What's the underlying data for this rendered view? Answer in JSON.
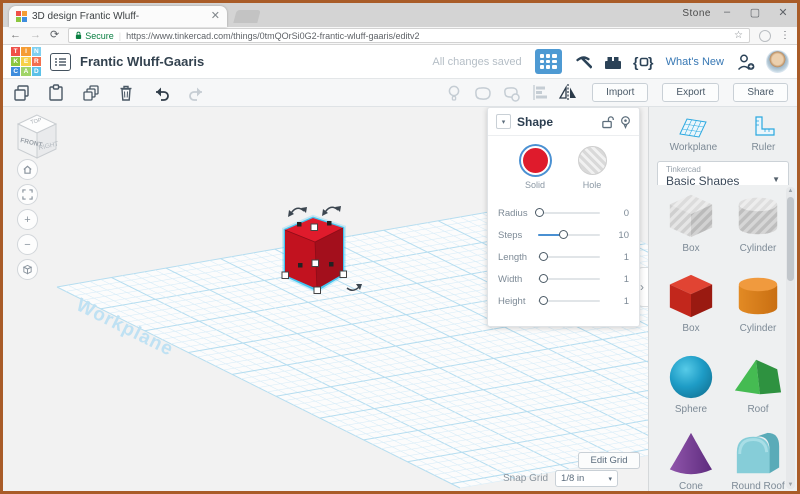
{
  "window": {
    "profile_name": "Stone"
  },
  "browser": {
    "tab_title": "3D design Frantic Wluff-",
    "secure_label": "Secure",
    "url": "https://www.tinkercad.com/things/0tmQOrSi0G2-frantic-wluff-gaaris/editv2"
  },
  "colors": {
    "accent_blue": "#4e9ad3",
    "selection_cyan": "#45c6f2",
    "cube_red": "#d6182b",
    "secure_green": "#0b8043",
    "link_blue": "#3878b4",
    "frame_orange": "#a95c28"
  },
  "app_header": {
    "logo": [
      {
        "ch": "T",
        "color": "#ef5048"
      },
      {
        "ch": "I",
        "color": "#f59c33"
      },
      {
        "ch": "N",
        "color": "#7fd0f0"
      },
      {
        "ch": "K",
        "color": "#8cc63f"
      },
      {
        "ch": "E",
        "color": "#f7d148"
      },
      {
        "ch": "R",
        "color": "#f2704d"
      },
      {
        "ch": "C",
        "color": "#3e8ddd"
      },
      {
        "ch": "A",
        "color": "#a0d468"
      },
      {
        "ch": "D",
        "color": "#5bc1e8"
      }
    ],
    "design_title": "Frantic Wluff-Gaaris",
    "save_status": "All changes saved",
    "whats_new_label": "What's New"
  },
  "toolbar": {
    "import_label": "Import",
    "export_label": "Export",
    "share_label": "Share"
  },
  "viewcube": {
    "top": "TOP",
    "front": "FRONT",
    "right": "RIGHT"
  },
  "canvas": {
    "workplane_watermark": "Workplane",
    "edit_grid_label": "Edit Grid",
    "snap_grid_label": "Snap Grid",
    "snap_grid_value": "1/8 in"
  },
  "shape_panel": {
    "title": "Shape",
    "options": [
      {
        "label": "Solid",
        "selected": true
      },
      {
        "label": "Hole",
        "selected": false
      }
    ],
    "sliders": [
      {
        "label": "Radius",
        "value": "0",
        "fill": 0.03
      },
      {
        "label": "Steps",
        "value": "10",
        "fill": 0.42
      },
      {
        "label": "Length",
        "value": "1",
        "fill": 0.1
      },
      {
        "label": "Width",
        "value": "1",
        "fill": 0.1
      },
      {
        "label": "Height",
        "value": "1",
        "fill": 0.1
      }
    ]
  },
  "sidebar": {
    "tools": [
      {
        "label": "Workplane"
      },
      {
        "label": "Ruler"
      }
    ],
    "library_group": "Tinkercad",
    "library_name": "Basic Shapes",
    "shapes": [
      {
        "label": "Box",
        "color": "striped-gray"
      },
      {
        "label": "Cylinder",
        "color": "striped-gray"
      },
      {
        "label": "Box",
        "color": "#c2271c"
      },
      {
        "label": "Cylinder",
        "color": "#df7d1e"
      },
      {
        "label": "Sphere",
        "color": "#1e9cc6"
      },
      {
        "label": "Roof",
        "color": "#3cb24c"
      },
      {
        "label": "Cone",
        "color": "#7d3f98"
      },
      {
        "label": "Round Roof",
        "color": "#86cdd8"
      }
    ]
  }
}
